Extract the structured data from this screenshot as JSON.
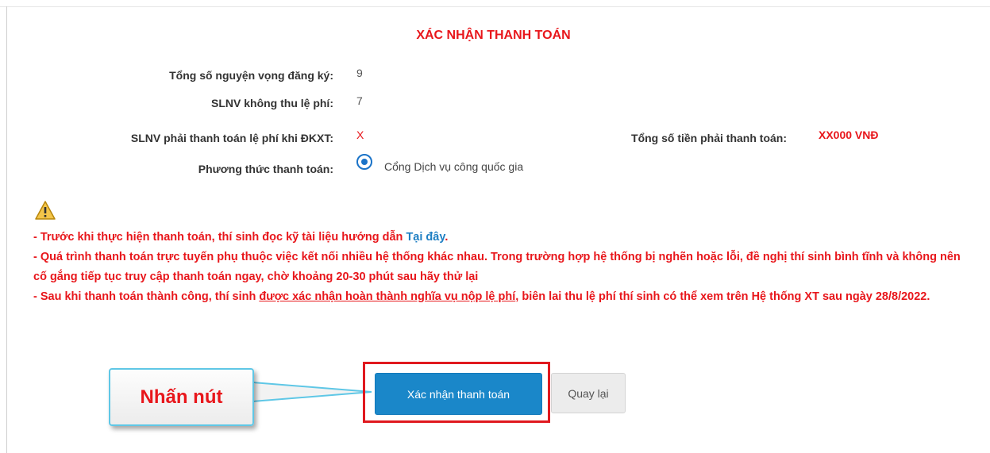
{
  "title": "XÁC NHẬN THANH TOÁN",
  "summary": {
    "total_label": "Tổng số nguyện vọng đăng ký:",
    "total_value": "9",
    "free_label": "SLNV không thu lệ phí:",
    "free_value": "7",
    "paid_label": "SLNV phải thanh toán lệ phí khi ĐKXT:",
    "paid_value": "X",
    "amount_label": "Tổng số tiền phải thanh toán:",
    "amount_value": "XX000 VNĐ",
    "method_label": "Phương thức thanh toán:",
    "method_option": "Cổng Dịch vụ công quốc gia"
  },
  "notes": {
    "line1_prefix": "- Trước khi thực hiện thanh toán, thí sinh đọc kỹ tài liệu hướng dẫn ",
    "line1_link": "Tại đây",
    "line1_suffix": ".",
    "line2": "- Quá trình thanh toán trực tuyến phụ thuộc việc kết nối nhiều hệ thống khác nhau. Trong trường hợp hệ thống bị nghẽn hoặc lỗi, đề nghị thí sinh bình tĩnh và không nên cố gắng tiếp tục truy cập thanh toán ngay, chờ khoảng 20-30 phút sau hãy thử lại",
    "line3_prefix": "- Sau khi thanh toán thành công, thí sinh ",
    "line3_underline": "được xác nhận hoàn thành nghĩa vụ nộp lệ phí",
    "line3_suffix": ", biên lai thu lệ phí thí sinh có thể xem trên Hệ thống XT sau ngày 28/8/2022."
  },
  "callout": "Nhấn nút",
  "buttons": {
    "confirm": "Xác nhận thanh toán",
    "back": "Quay lại"
  },
  "colors": {
    "accent_red": "#e8161b",
    "primary_blue": "#1a87c9",
    "link_blue": "#1e7fc3",
    "highlight_border": "#e0191f",
    "callout_border": "#5fc7e6"
  },
  "icons": {
    "warning": "warning-triangle-icon",
    "radio": "radio-selected"
  }
}
